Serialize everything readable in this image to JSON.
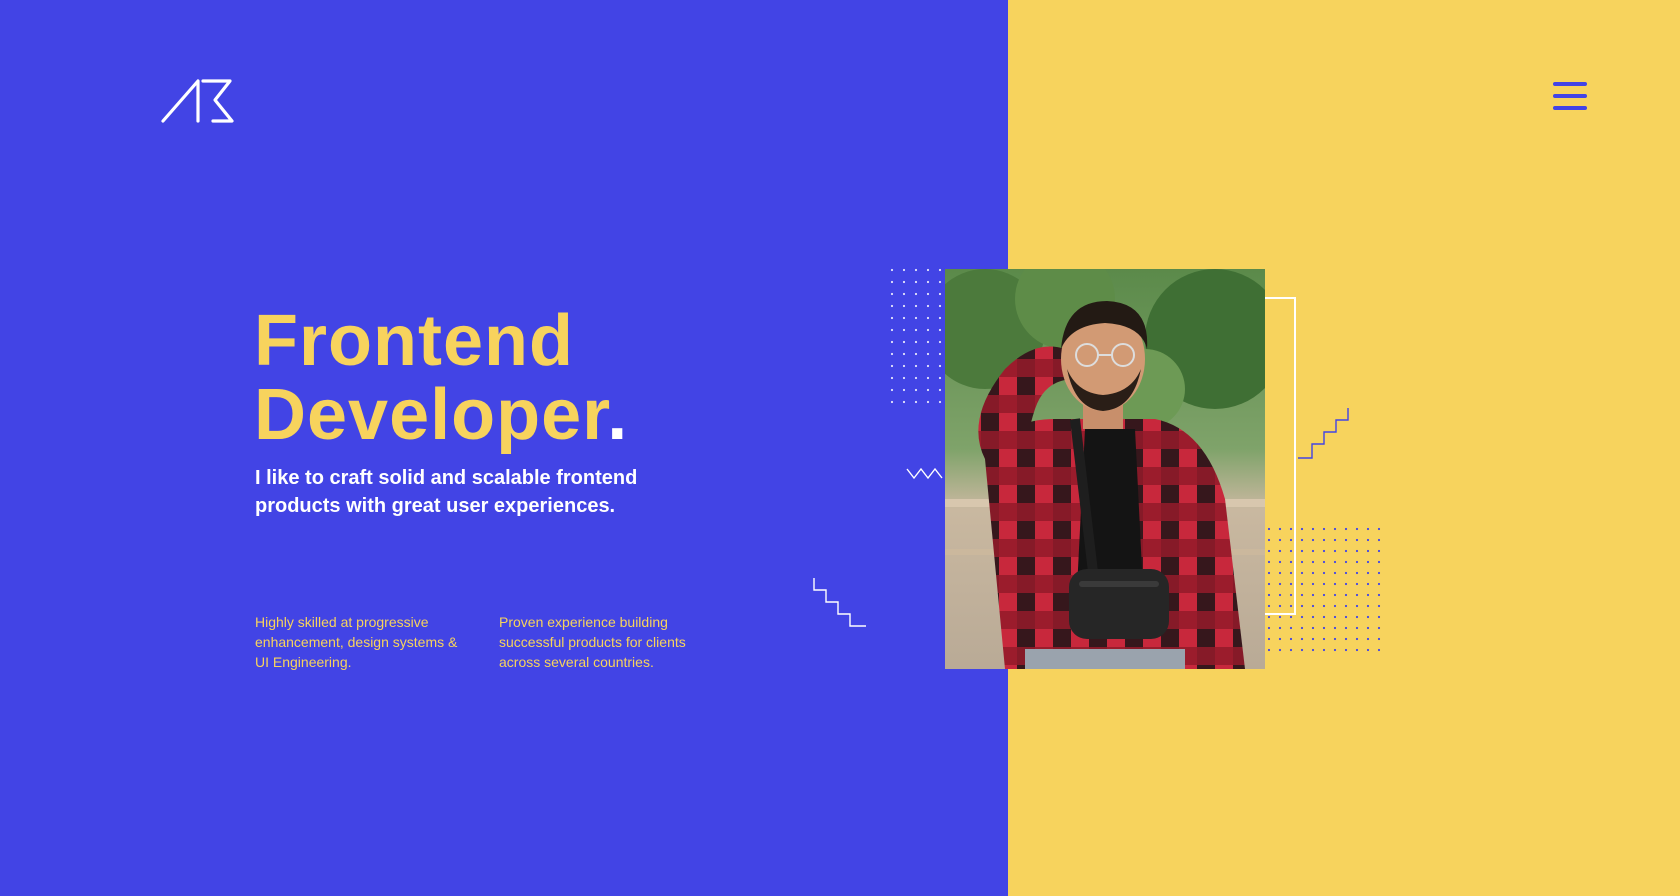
{
  "header": {
    "logo_text": "AB",
    "menu_icon": "hamburger-menu-icon"
  },
  "hero": {
    "title_line1": "Frontend",
    "title_line2": "Developer",
    "title_dot": ".",
    "subtitle": "I like to craft solid and scalable frontend products with great user experiences."
  },
  "features": [
    {
      "text": "Highly skilled at progressive enhancement, design systems & UI Engineering."
    },
    {
      "text": "Proven experience building successful products for clients across several countries."
    }
  ],
  "portrait": {
    "icon": "profile-photo"
  },
  "colors": {
    "primary_blue": "#4244e5",
    "accent_yellow": "#f7d35d",
    "white": "#ffffff",
    "shirt_red": "#c8283c"
  }
}
